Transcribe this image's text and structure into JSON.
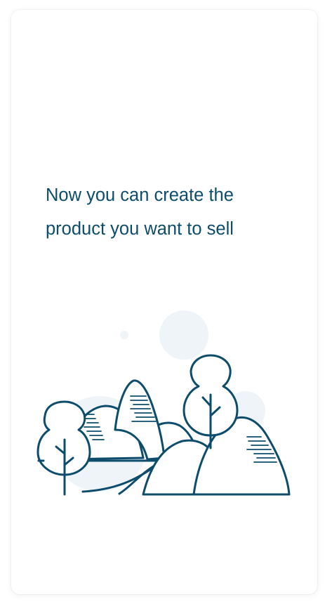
{
  "headline": {
    "line1": "Now you can create the",
    "line2": "product you want to sell"
  },
  "illustration": {
    "icon": "landscape-trees-mountains-icon",
    "stroke_color": "#0d4d6b",
    "bubble_color": "#eef4f8"
  }
}
